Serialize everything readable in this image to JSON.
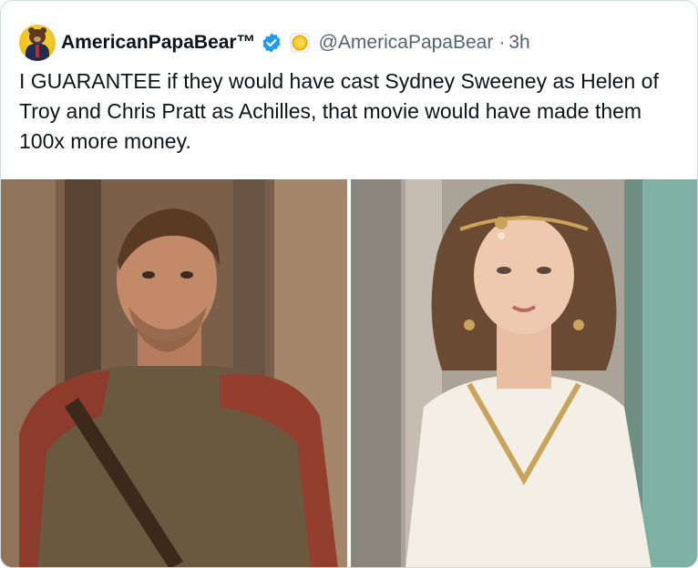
{
  "tweet": {
    "author_name": "AmericanPapaBear™",
    "handle": "@AmericaPapaBear",
    "separator": "·",
    "time": "3h",
    "text": "I GUARANTEE if they would have cast Sydney Sweeney as Helen of Troy and Chris Pratt as Achilles, that movie would have made them 100x more money."
  },
  "icons": {
    "avatar": "bear-avatar-icon",
    "verified": "verified-badge-icon",
    "coin": "gold-coin-icon"
  },
  "colors": {
    "verified_blue": "#1d9bf0",
    "name": "#0f1419",
    "secondary_text": "#536471",
    "border": "#cfd9de"
  },
  "media": {
    "left_photo": "achilles-photo",
    "right_photo": "helen-photo"
  }
}
